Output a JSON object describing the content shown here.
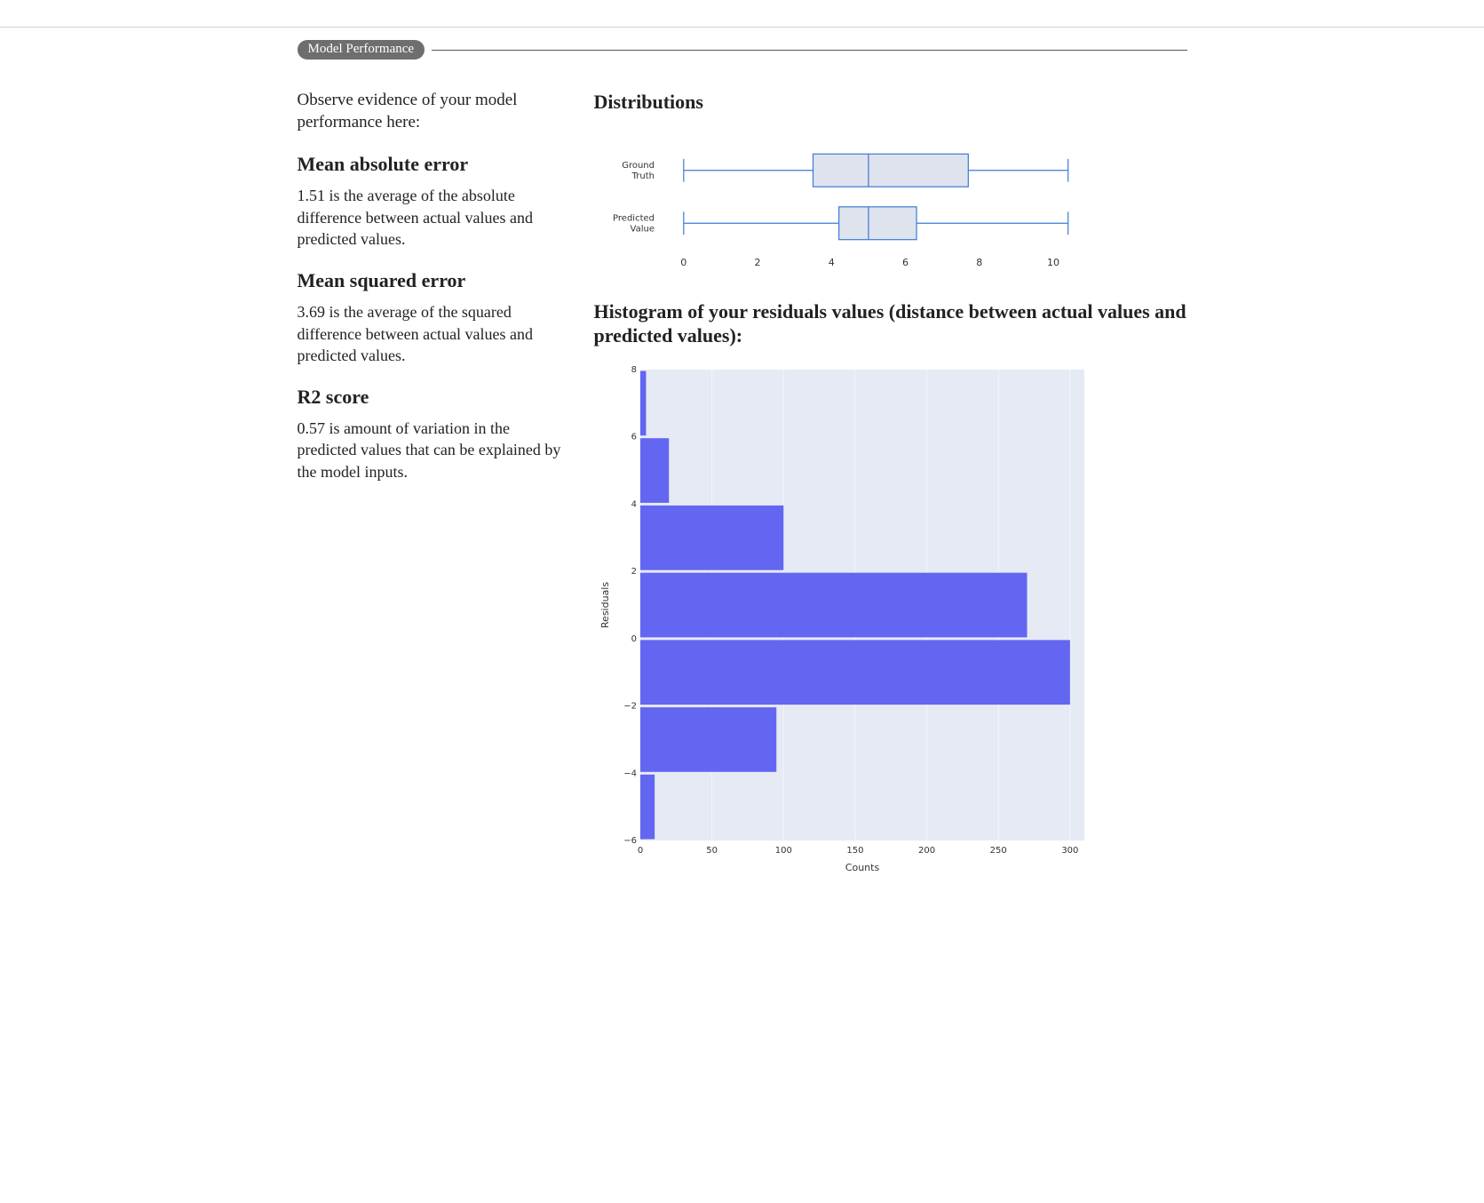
{
  "section_title": "Model Performance",
  "intro": "Observe evidence of your model performance here:",
  "metrics": {
    "mae": {
      "heading": "Mean absolute error",
      "desc": "1.51 is the average of the absolute difference between actual values and predicted values."
    },
    "mse": {
      "heading": "Mean squared error",
      "desc": "3.69 is the average of the squared difference between actual values and predicted values."
    },
    "r2": {
      "heading": "R2 score",
      "desc": "0.57 is amount of variation in the predicted values that can be explained by the model inputs."
    }
  },
  "right": {
    "dist_heading": "Distributions",
    "hist_heading": "Histogram of your residuals values (distance between actual values and predicted values):"
  },
  "chart_data": [
    {
      "type": "boxplot",
      "title": "Distributions",
      "orientation": "horizontal",
      "xlim": [
        -0.5,
        10.6
      ],
      "xticks": [
        0,
        2,
        4,
        6,
        8,
        10
      ],
      "categories": [
        "Ground Truth",
        "Predicted Value"
      ],
      "series": [
        {
          "name": "Ground Truth",
          "min": 0.0,
          "q1": 3.5,
          "median": 5.0,
          "q3": 7.7,
          "max": 10.4
        },
        {
          "name": "Predicted Value",
          "min": 0.0,
          "q1": 4.2,
          "median": 5.0,
          "q3": 6.3,
          "max": 10.4
        }
      ]
    },
    {
      "type": "barh",
      "title": "Histogram of residuals",
      "xlabel": "Counts",
      "ylabel": "Residuals",
      "xlim": [
        0,
        310
      ],
      "xticks": [
        0,
        50,
        100,
        150,
        200,
        250,
        300
      ],
      "ylim": [
        -6,
        8
      ],
      "yticks": [
        -6,
        -4,
        -2,
        0,
        2,
        4,
        6,
        8
      ],
      "bins": [
        {
          "y0": 6,
          "y1": 8,
          "count": 4
        },
        {
          "y0": 4,
          "y1": 6,
          "count": 20
        },
        {
          "y0": 2,
          "y1": 4,
          "count": 100
        },
        {
          "y0": 0,
          "y1": 2,
          "count": 270
        },
        {
          "y0": -2,
          "y1": 0,
          "count": 300
        },
        {
          "y0": -4,
          "y1": -2,
          "count": 95
        },
        {
          "y0": -6,
          "y1": -4,
          "count": 10
        }
      ]
    }
  ]
}
